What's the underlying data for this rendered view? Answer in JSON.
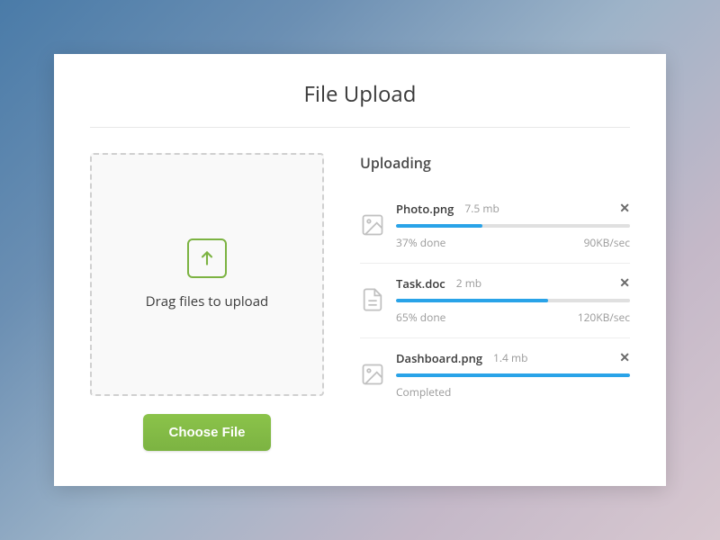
{
  "title": "File Upload",
  "dropzone": {
    "text": "Drag files to upload"
  },
  "chooseButton": "Choose File",
  "uploadingLabel": "Uploading",
  "completedLabel": "Completed",
  "files": [
    {
      "name": "Photo.png",
      "size": "7.5 mb",
      "progress": 37,
      "progressText": "37% done",
      "speed": "90KB/sec",
      "type": "image",
      "completed": false
    },
    {
      "name": "Task.doc",
      "size": "2 mb",
      "progress": 65,
      "progressText": "65% done",
      "speed": "120KB/sec",
      "type": "document",
      "completed": false
    },
    {
      "name": "Dashboard.png",
      "size": "1.4 mb",
      "progress": 100,
      "progressText": "",
      "speed": "",
      "type": "image",
      "completed": true
    }
  ]
}
